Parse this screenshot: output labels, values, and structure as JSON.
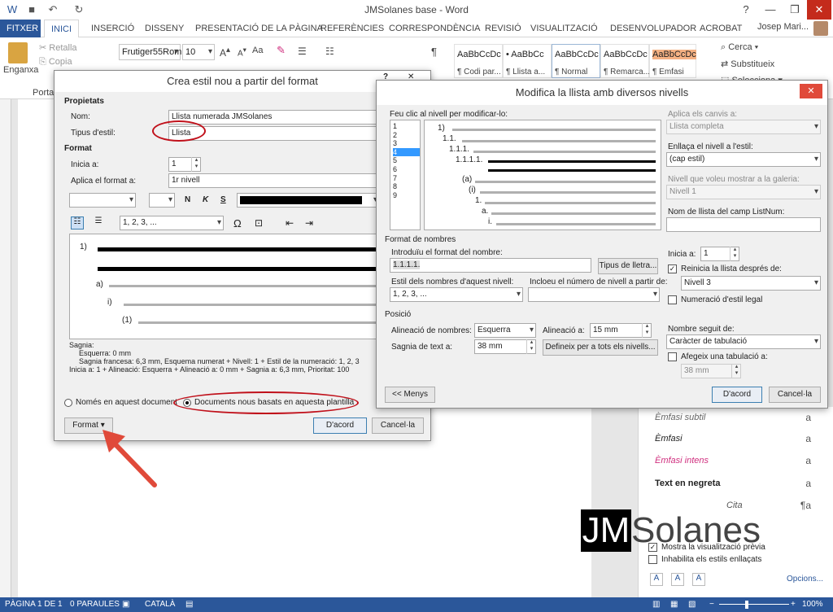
{
  "window": {
    "title": "JMSolanes base - Word",
    "user": "Josep Mari..."
  },
  "tabs": [
    "FITXER",
    "INICI",
    "INSERCIÓ",
    "DISSENY",
    "PRESENTACIÓ DE LA PÀGINA",
    "REFERÈNCIES",
    "CORRESPONDÈNCIA",
    "REVISIÓ",
    "VISUALITZACIÓ",
    "DESENVOLUPADOR",
    "ACROBAT"
  ],
  "ribbon": {
    "paste": "Enganxa",
    "cut": "Retalla",
    "copy": "Copia",
    "clipboard": "Porta-",
    "font": "Frutiger55Rom",
    "size": "10",
    "aa": "Aa",
    "styles": [
      {
        "preview": "AaBbCcDc",
        "name": "¶ Codi par..."
      },
      {
        "preview": "• AaBbCc",
        "name": "¶ Llista a..."
      },
      {
        "preview": "AaBbCcDc",
        "name": "¶ Normal"
      },
      {
        "preview": "AaBbCcDc",
        "name": "¶ Remarca..."
      },
      {
        "preview": "AaBbCcDc",
        "name": "¶ Emfasi"
      }
    ],
    "find": "Cerca",
    "replace": "Substitueix",
    "select": "Selecciona"
  },
  "dialog1": {
    "title": "Crea estil nou a partir del format",
    "props_group": "Propietats",
    "name_label": "Nom:",
    "name_value": "Llista numerada JMSolanes",
    "type_label": "Tipus d'estil:",
    "type_value": "Llista",
    "format_group": "Format",
    "start_label": "Inicia a:",
    "start_value": "1",
    "apply_label": "Aplica el format a:",
    "apply_value": "1r nivell",
    "b": "N",
    "i": "K",
    "u": "S",
    "numfmt": "1, 2, 3, ...",
    "omega": "Ω",
    "preview_labels": [
      "1)",
      "a)",
      "i)",
      "(1)"
    ],
    "desc": [
      "Sagnia:",
      "Esquerra: 0 mm",
      "Sagnia francesa: 6,3 mm, Esquema numerat + Nivell: 1 + Estil de la numeració: 1, 2, 3",
      "Inicia a: 1 + Alineació: Esquerra + Alineació a: 0 mm + Sagnia a: 6,3 mm, Prioritat: 100"
    ],
    "radio1": "Només en aquest document",
    "radio2": "Documents nous basats en aquesta plantilla",
    "format_btn": "Format",
    "ok": "D'acord",
    "cancel": "Cancel·la"
  },
  "dialog2": {
    "title": "Modifica la llista amb diversos nivells",
    "help": "?",
    "close": "✕",
    "level_click_label": "Feu clic al nivell per modificar-lo:",
    "levels": [
      "1",
      "2",
      "3",
      "4",
      "5",
      "6",
      "7",
      "8",
      "9"
    ],
    "selected_level": 4,
    "preview_labels": [
      "1)",
      "1.1.",
      "1.1.1.",
      "1.1.1.1.",
      "(a)",
      "(i)",
      "1.",
      "a.",
      "i."
    ],
    "apply_changes_label": "Aplica els canvis a:",
    "apply_changes_value": "Llista completa",
    "link_label": "Enllaça el nivell a l'estil:",
    "link_value": "(cap estil)",
    "gallery_label": "Nivell que voleu mostrar a la galeria:",
    "gallery_value": "Nivell 1",
    "listnum_label": "Nom de llista del camp ListNum:",
    "numfmt_group": "Format de nombres",
    "enter_fmt_label": "Introduïu el format del nombre:",
    "enter_fmt_value": "1.1.1.1.",
    "font_btn": "Tipus de lletra...",
    "style_label": "Estil dels nombres d'aquest nivell:",
    "style_value": "1, 2, 3, ...",
    "include_label": "Incloeu el número de nivell a partir de:",
    "start_label": "Inicia a:",
    "start_value": "1",
    "restart_label": "Reinicia la llista després de:",
    "restart_value": "Nivell 3",
    "legal_label": "Numeració d'estil legal",
    "pos_group": "Posició",
    "align_label": "Alineació de nombres:",
    "align_value": "Esquerra",
    "align_at_label": "Alineació a:",
    "align_at_value": "15 mm",
    "indent_label": "Sagnia de text a:",
    "indent_value": "38 mm",
    "define_btn": "Defineix per a tots els nivells...",
    "follow_label": "Nombre seguit de:",
    "follow_value": "Caràcter de tabulació",
    "addtab_label": "Afegeix una tabulació a:",
    "addtab_value": "38 mm",
    "less_btn": "<< Menys",
    "ok": "D'acord",
    "cancel": "Cancel·la"
  },
  "styles_pane": [
    {
      "name": "Èmfasi subtil",
      "glyph": "a"
    },
    {
      "name": "Èmfasi",
      "glyph": "a"
    },
    {
      "name": "Èmfasi intens",
      "glyph": "a"
    },
    {
      "name": "Text en negreta",
      "glyph": "a"
    },
    {
      "name": "Cita",
      "glyph": "¶a"
    }
  ],
  "pane_opts": {
    "preview": "Mostra la visualització prèvia",
    "disable_linked": "Inhabilita els estils enllaçats",
    "options": "Opcions..."
  },
  "watermark": "JMSolanes",
  "status": {
    "page": "PÀGINA 1 DE 1",
    "words": "0 PARAULES",
    "lang": "CATALÀ",
    "zoom": "100%"
  },
  "colors": {
    "accent": "#2b579a",
    "highlight": "#c0101a"
  }
}
